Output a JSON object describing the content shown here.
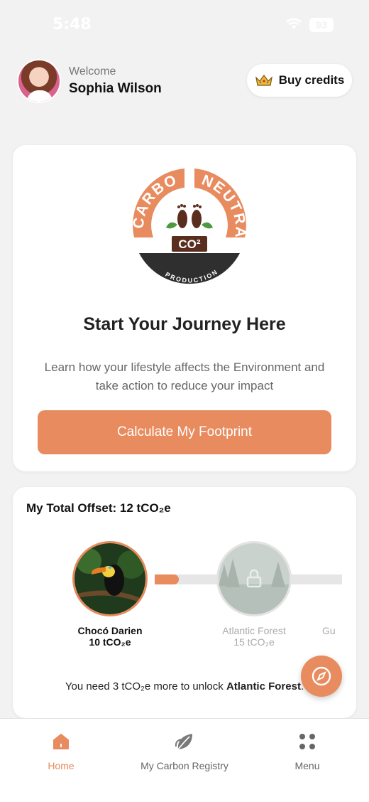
{
  "status": {
    "time": "5:48",
    "battery": "93"
  },
  "header": {
    "welcome": "Welcome",
    "user_name": "Sophia Wilson",
    "buy_credits": "Buy credits"
  },
  "journey": {
    "logo_top_left": "CARBON",
    "logo_top_right": "NEUTRAL",
    "logo_badge": "CO²",
    "logo_bottom": "PRODUCTION",
    "title": "Start Your Journey Here",
    "description": "Learn how your lifestyle affects the Environment and take action to reduce your impact",
    "cta": "Calculate My Footprint"
  },
  "offset": {
    "title": "My Total Offset: 12 tCO₂e",
    "progress_fraction": 0.13,
    "projects": [
      {
        "name": "Chocó Darien",
        "amount": "10 tCO₂e",
        "unlocked": true
      },
      {
        "name": "Atlantic Forest",
        "amount": "15 tCO₂e",
        "unlocked": false
      },
      {
        "name": "Gu",
        "amount": "",
        "unlocked": false
      }
    ],
    "unlock_prefix": "You need 3 tCO₂e more to unlock ",
    "unlock_target": "Atlantic Forest",
    "unlock_suffix": "."
  },
  "nav": {
    "items": [
      {
        "label": "Home",
        "icon": "home-icon"
      },
      {
        "label": "My Carbon Registry",
        "icon": "leaf-icon"
      },
      {
        "label": "Menu",
        "icon": "dots-grid-icon"
      }
    ]
  },
  "colors": {
    "accent": "#e88b5e",
    "dark": "#2f2f2f",
    "badge": "#5a2e1f"
  }
}
